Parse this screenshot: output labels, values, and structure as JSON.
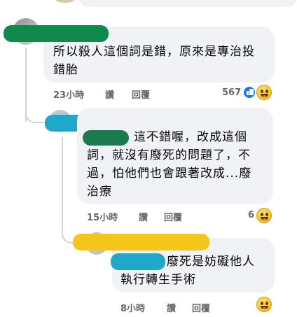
{
  "comments": [
    {
      "text_lines": [
        "所以殺人這個詞是錯，原來是專治投",
        "錯胎"
      ],
      "time": "23小時",
      "like_label": "讚",
      "reply_label": "回覆",
      "reaction_count": "567",
      "reaction_icons": [
        "like-icon",
        "haha-icon"
      ]
    },
    {
      "text_lines": [
        "這不錯喔，改成這個",
        "詞，就沒有廢死的問題了，不",
        "過，怕他們也會跟著改成...廢",
        "治療"
      ],
      "time": "15小時",
      "like_label": "讚",
      "reply_label": "回覆",
      "reaction_count": "6",
      "reaction_icons": [
        "haha-icon"
      ]
    },
    {
      "text_lines": [
        "廢死是妨礙他人",
        "執行轉生手術"
      ],
      "time": "8小時",
      "like_label": "讚",
      "reply_label": "回覆",
      "reaction_count": "",
      "reaction_icons": [
        "haha-icon"
      ]
    }
  ],
  "redaction_colors": {
    "name_1": "#0f8a4c",
    "name_2": "#1fa8c9",
    "tag_2": "#1a7a50",
    "name_3": "#f4c61a",
    "tag_3": "#1fa8c9"
  },
  "colors": {
    "bubble": "#f0f2f5",
    "meta_text": "#65676b",
    "like_blue": "#1877f2"
  }
}
